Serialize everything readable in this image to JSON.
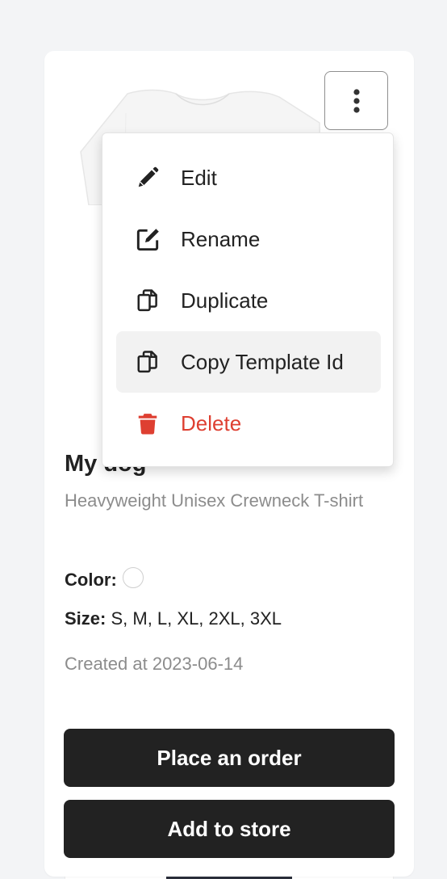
{
  "product": {
    "title": "My dog",
    "subtitle": "Heavyweight Unisex Crewneck T-shirt",
    "color_label": "Color:",
    "size_label": "Size:",
    "sizes": "S, M, L, XL, 2XL, 3XL",
    "created": "Created at 2023-06-14"
  },
  "menu": {
    "items": [
      {
        "label": "Edit",
        "icon": "pencil-icon"
      },
      {
        "label": "Rename",
        "icon": "edit-square-icon"
      },
      {
        "label": "Duplicate",
        "icon": "copy-icon"
      },
      {
        "label": "Copy Template Id",
        "icon": "copy-icon"
      },
      {
        "label": "Delete",
        "icon": "trash-icon"
      }
    ]
  },
  "actions": {
    "place_order": "Place an order",
    "add_to_store": "Add to store"
  },
  "colors": {
    "primary_button": "#222222",
    "danger": "#de3f31",
    "muted_text": "#8c8c8c",
    "background": "#f3f4f6"
  }
}
